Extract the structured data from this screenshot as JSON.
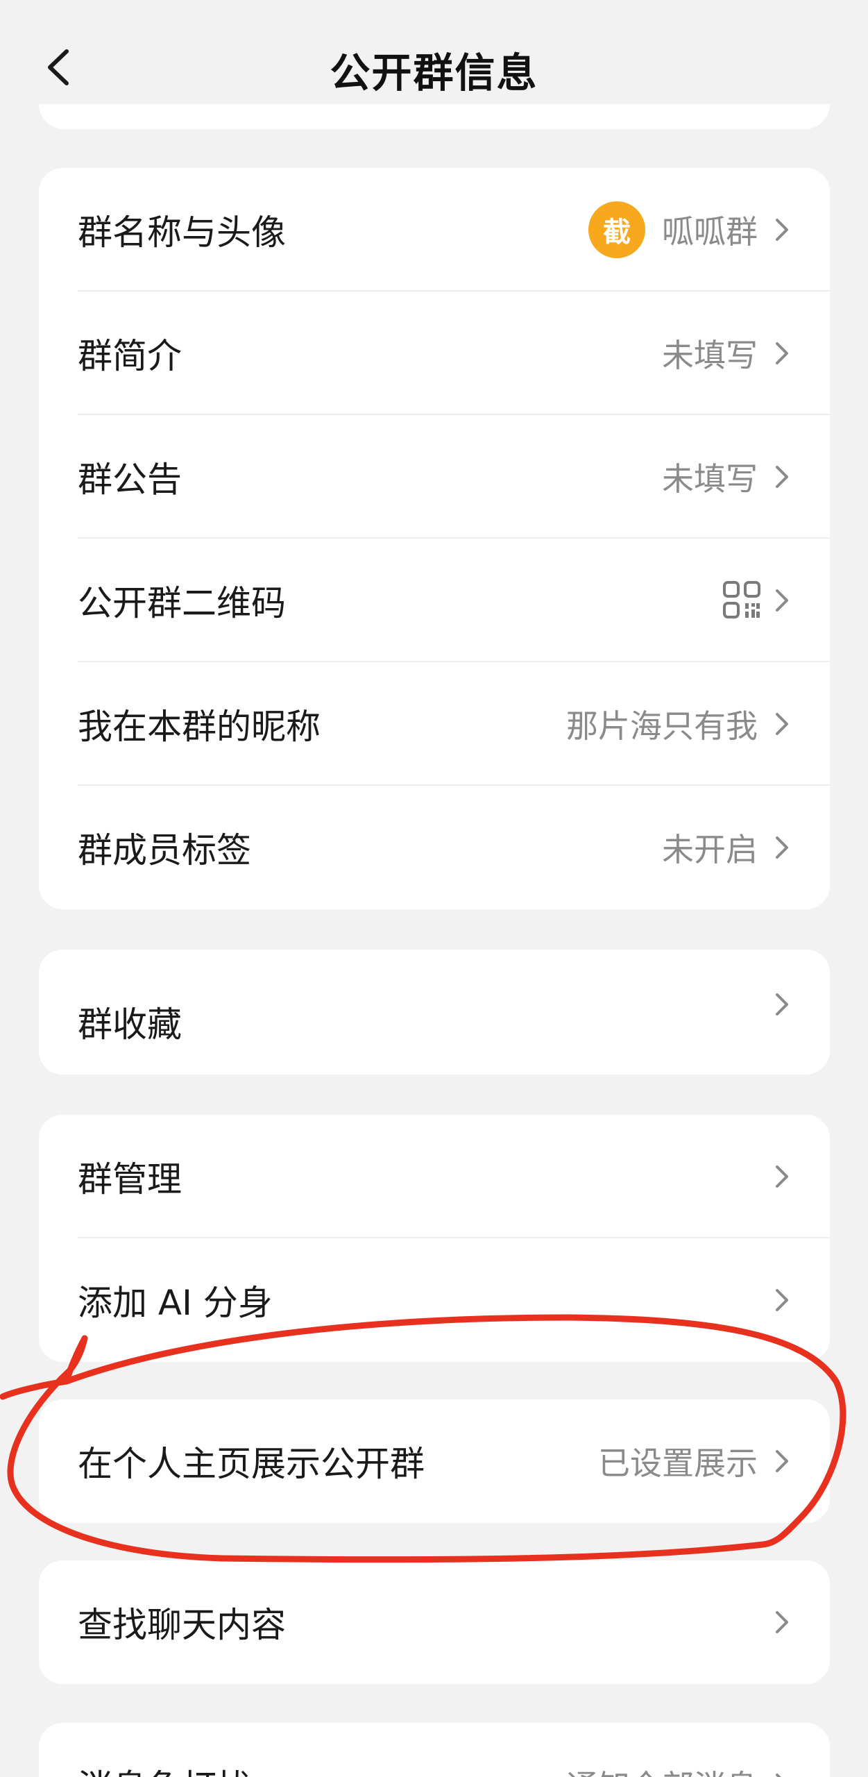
{
  "header": {
    "title": "公开群信息"
  },
  "group_info": {
    "name_avatar": {
      "label": "群名称与头像",
      "avatar_text": "截",
      "value": "呱呱群"
    },
    "intro": {
      "label": "群简介",
      "value": "未填写"
    },
    "notice": {
      "label": "群公告",
      "value": "未填写"
    },
    "qr_code": {
      "label": "公开群二维码",
      "icon": "qr-code-icon"
    },
    "nickname": {
      "label": "我在本群的昵称",
      "value": "那片海只有我"
    },
    "member_tags": {
      "label": "群成员标签",
      "value": "未开启"
    }
  },
  "favorites": {
    "label": "群收藏"
  },
  "management": {
    "manage": {
      "label": "群管理"
    },
    "ai_clone": {
      "label": "添加 AI 分身"
    }
  },
  "profile_display": {
    "label": "在个人主页展示公开群",
    "value": "已设置展示"
  },
  "search_chat": {
    "label": "查找聊天内容"
  },
  "do_not_disturb": {
    "label": "消息免打扰",
    "value": "通知全部消息"
  },
  "colors": {
    "background": "#f2f2f2",
    "card": "#ffffff",
    "avatar": "#f8a81c",
    "secondary_text": "#8a8a8a",
    "annotation_red": "#e8301e"
  }
}
